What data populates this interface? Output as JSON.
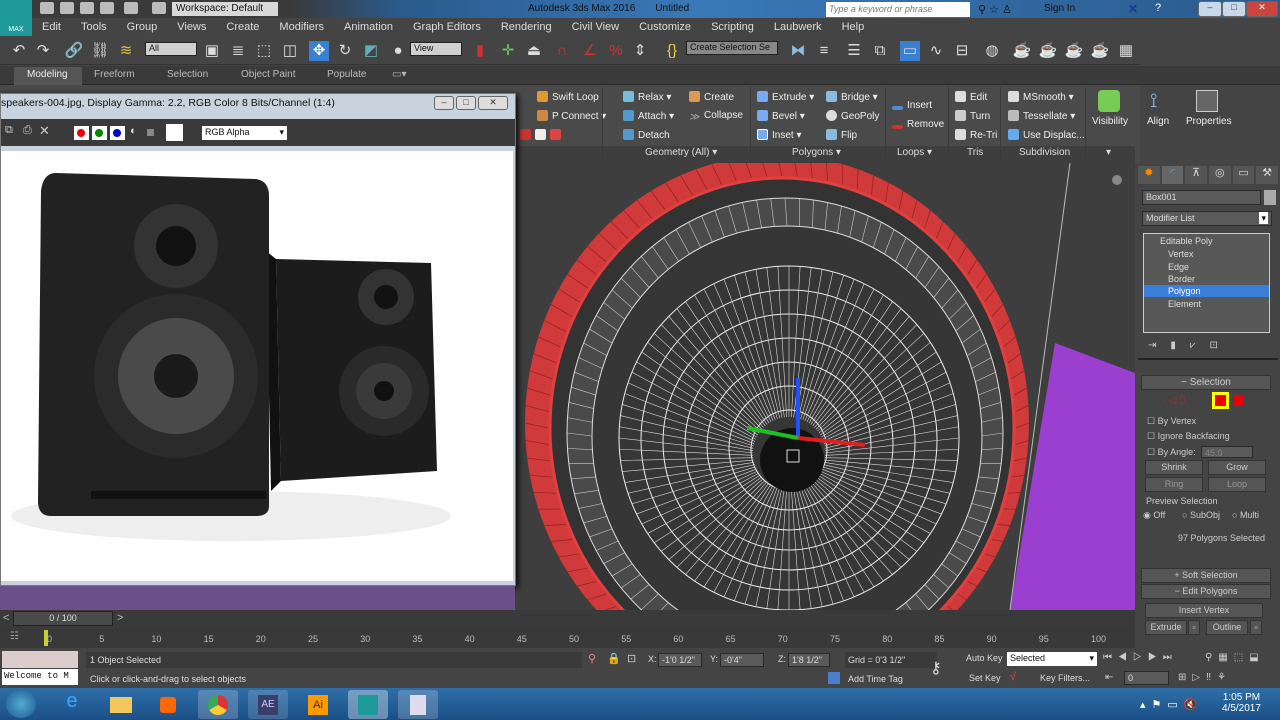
{
  "app": {
    "logo": "MAX",
    "workspace": "Workspace: Default",
    "title": "Autodesk 3ds Max 2016",
    "document": "Untitled",
    "search_placeholder": "Type a keyword or phrase",
    "sign_in": "Sign In"
  },
  "menu": [
    "Edit",
    "Tools",
    "Group",
    "Views",
    "Create",
    "Modifiers",
    "Animation",
    "Graph Editors",
    "Rendering",
    "Civil View",
    "Customize",
    "Scripting",
    "Laubwerk",
    "Help"
  ],
  "toolbar": {
    "selection_filter": "All",
    "ref_coord": "View",
    "named_selection": "Create Selection Se"
  },
  "ribbon_tabs": [
    "Modeling",
    "Freeform",
    "Selection",
    "Object Paint",
    "Populate"
  ],
  "ribbon": {
    "edit": [
      "Swift Loop",
      "P Connect"
    ],
    "geometry": [
      "Relax",
      "Create",
      "Attach",
      "Collapse",
      "Detach"
    ],
    "geometry_label": "Geometry (All)",
    "polygons": [
      "Extrude",
      "Bridge",
      "Bevel",
      "GeoPoly",
      "Inset",
      "Flip"
    ],
    "polygons_label": "Polygons",
    "loops": [
      "Insert",
      "Remove"
    ],
    "loops_label": "Loops",
    "tris": [
      "Edit",
      "Turn",
      "Re-Tri"
    ],
    "tris_label": "Tris",
    "subdivision": [
      "MSmooth",
      "Tessellate",
      "Use Displac..."
    ],
    "subdivision_label": "Subdivision",
    "visibility": "Visibility",
    "align": "Align",
    "properties": "Properties"
  },
  "image_window": {
    "title": "speakers-004.jpg, Display Gamma: 2.2, RGB Color 8 Bits/Channel (1:4)",
    "channel": "RGB Alpha"
  },
  "command_panel": {
    "object_name": "Box001",
    "modifier_list": "Modifier List",
    "stack": [
      "Editable Poly",
      "Vertex",
      "Edge",
      "Border",
      "Polygon",
      "Element"
    ],
    "selection_title": "Selection",
    "by_vertex": "By Vertex",
    "ignore_backfacing": "Ignore Backfacing",
    "by_angle": "By Angle:",
    "angle_value": "45.0",
    "shrink": "Shrink",
    "grow": "Grow",
    "ring": "Ring",
    "loop": "Loop",
    "preview_selection": "Preview Selection",
    "preview_opts": [
      "Off",
      "SubObj",
      "Multi"
    ],
    "selected_count": "97 Polygons Selected",
    "soft_selection": "Soft Selection",
    "edit_polygons": "Edit Polygons",
    "insert_vertex": "Insert Vertex",
    "extrude": "Extrude",
    "outline": "Outline"
  },
  "timeline": {
    "frame": "0 / 100",
    "ticks": [
      "0",
      "5",
      "10",
      "15",
      "20",
      "25",
      "30",
      "35",
      "40",
      "45",
      "50",
      "55",
      "60",
      "65",
      "70",
      "75",
      "80",
      "85",
      "90",
      "95",
      "100"
    ]
  },
  "status": {
    "selected": "1 Object Selected",
    "prompt": "Click or click-and-drag to select objects",
    "listener": "Welcome to M",
    "x": "-1'0 1/2\"",
    "y": "-0'4\"",
    "z": "1'8 1/2\"",
    "grid": "Grid = 0'3 1/2\"",
    "add_time_tag": "Add Time Tag",
    "auto_key": "Auto Key",
    "set_key": "Set Key",
    "key_mode": "Selected",
    "key_filters": "Key Filters...",
    "current_frame": "0",
    "x_label": "X:",
    "y_label": "Y:",
    "z_label": "Z:"
  },
  "taskbar": {
    "apps": [
      "Start",
      "Internet Explorer",
      "File Explorer",
      "Media Player",
      "Chrome",
      "After Effects",
      "Illustrator",
      "3ds Max",
      "Notepad"
    ],
    "ae": "AE",
    "ai": "Ai",
    "time": "1:05 PM",
    "date": "4/5/2017"
  }
}
